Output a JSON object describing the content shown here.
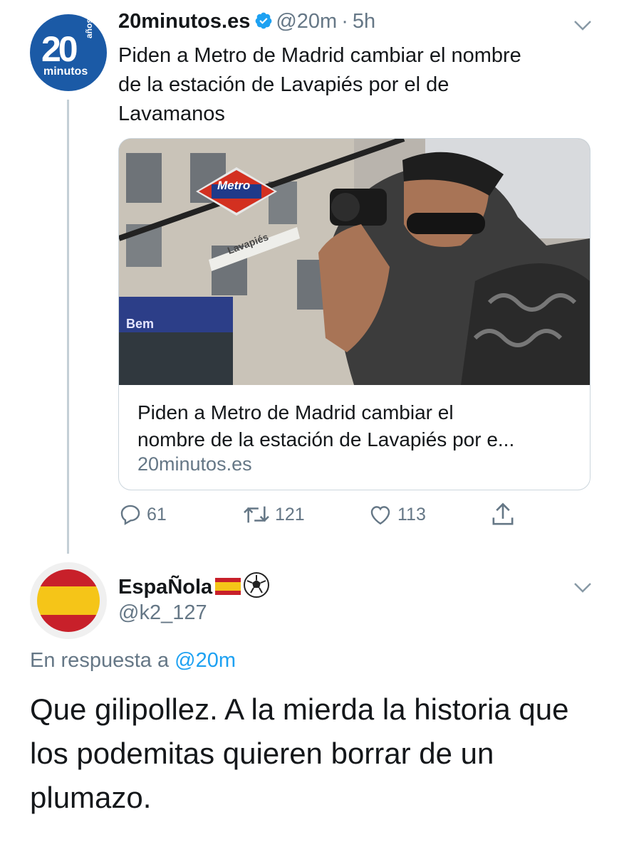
{
  "tweet": {
    "avatar": {
      "line1": "20",
      "line2": "años",
      "line3": "minutos"
    },
    "name": "20minutos.es",
    "handle": "@20m",
    "separator": "·",
    "time": "5h",
    "text_lines": [
      "Piden a Metro de Madrid cambiar el nombre",
      "de la estación de Lavapiés por el de",
      "Lavamanos"
    ],
    "card": {
      "sign_metro": "Metro",
      "sign_street": "Lavapiés",
      "sign_shop": "Bem",
      "title_lines": [
        "Piden a Metro de Madrid cambiar el",
        "nombre de la estación de Lavapiés por e..."
      ],
      "domain": "20minutos.es"
    },
    "actions": {
      "replies": "61",
      "retweets": "121",
      "likes": "113"
    }
  },
  "reply": {
    "name": "EspaÑola",
    "handle": "@k2_127",
    "in_reply_prefix": "En respuesta a",
    "in_reply_handle": "@20m",
    "text_lines": [
      "Que gilipollez. A la mierda la historia que",
      "los podemitas quieren borrar de un",
      "plumazo."
    ]
  },
  "colors": {
    "brand_blue": "#1b5aa6",
    "link": "#1da1f2",
    "muted": "#657786",
    "verified": "#1da1f2",
    "thread_line": "#c4cfd6"
  },
  "icons": [
    "verified-badge-icon",
    "chevron-down-icon",
    "reply-icon",
    "retweet-icon",
    "like-icon",
    "share-icon",
    "spain-flag-icon",
    "soccer-ball-icon"
  ]
}
